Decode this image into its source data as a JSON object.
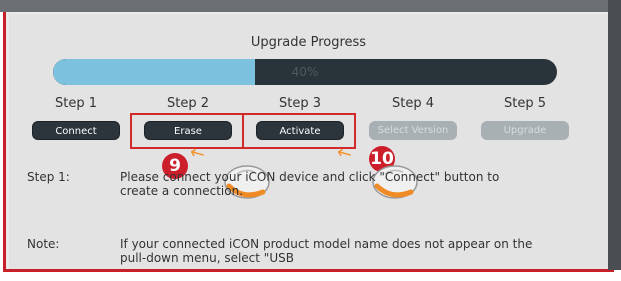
{
  "dialog": {
    "title": "Upgrade Progress"
  },
  "progress": {
    "value": 0.4,
    "label": "40%"
  },
  "steps": [
    {
      "label": "Step 1",
      "button": "Connect",
      "state": "enabled"
    },
    {
      "label": "Step 2",
      "button": "Erase",
      "state": "enabled"
    },
    {
      "label": "Step 3",
      "button": "Activate",
      "state": "enabled"
    },
    {
      "label": "Step 4",
      "button": "Select Version",
      "state": "disabled"
    },
    {
      "label": "Step 5",
      "button": "Upgrade",
      "state": "disabled"
    }
  ],
  "annotations": [
    {
      "number": "9"
    },
    {
      "number": "10"
    }
  ],
  "instructions": [
    {
      "label": "Step 1:",
      "text": "Please connect your iCON device and click \"Connect\" button to create a connection."
    },
    {
      "label": "Note:",
      "text": "If your connected iCON product model name does not appear on the pull-down menu, select \"USB"
    }
  ],
  "colors": {
    "progress_fill": "#7cc1de",
    "progress_track": "#28343a",
    "highlight": "#d12a2a",
    "badge": "#cc1f2c"
  },
  "icons": [
    "mouse-click-icon",
    "arrow-icon"
  ]
}
